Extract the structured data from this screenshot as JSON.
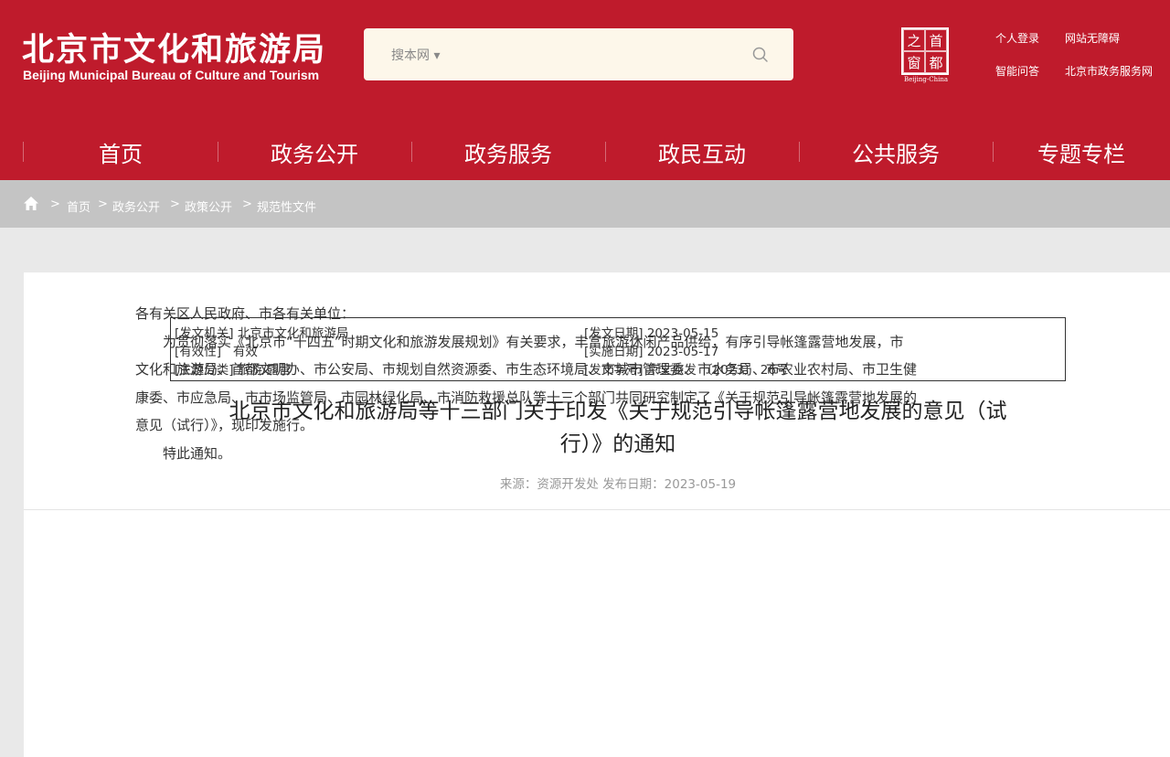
{
  "header": {
    "site_name_cn": "北京市文化和旅游局",
    "site_name_en": "Beijing Municipal Bureau of Culture and Tourism",
    "search": {
      "scope_label": "搜本网 ▾",
      "placeholder": ""
    },
    "capital_logo": {
      "chars": [
        "之",
        "首",
        "窗",
        "都"
      ],
      "en": "Beijing-China"
    },
    "links": {
      "login": "个人登录",
      "accessibility": "网站无障碍",
      "qa": "智能问答",
      "gov_service": "北京市政务服务网"
    },
    "brand_color": "#bf1b2c"
  },
  "nav": {
    "items": [
      {
        "label": "首页"
      },
      {
        "label": "政务公开"
      },
      {
        "label": "政务服务"
      },
      {
        "label": "政民互动"
      },
      {
        "label": "公共服务"
      },
      {
        "label": "专题专栏"
      }
    ]
  },
  "breadcrumb": {
    "sep": ">",
    "items": [
      "首页",
      "政务公开",
      "政策公开",
      "规范性文件"
    ]
  },
  "meta": {
    "issuer_label": "[发文机关]",
    "issuer": "北京市文化和旅游局",
    "validity_label": "[有效性]",
    "validity": "有效",
    "topic_label": "[主题分类]",
    "topic": "旅游/露营",
    "issue_date_label": "[发文日期]",
    "issue_date": "2023-05-15",
    "effective_date_label": "[实施日期]",
    "effective_date": "2023-05-17",
    "doc_no_label": "[发文字号]",
    "doc_no": "京文旅发 〔2023〕 26号"
  },
  "article": {
    "title_line1": "北京市文化和旅游局等十三部门关于印发《关于规范引导帐篷露营地发展的意见（试",
    "title_line2": "行）》的通知",
    "source": "来源：资源开发处   发布日期：2023-05-19",
    "salutation": "各有关区人民政府、市各有关单位：",
    "para1_l1": "为贯彻落实《北京市“十四五”时期文化和旅游发展规划》有关要求，丰富旅游休闲产品供给，有序引导帐篷露营地发展，市",
    "para1_l2": "文化和旅游局、首都文明办、市公安局、市规划自然资源委、市生态环境局、市城市管理委、市水务局、市农业农村局、市卫生健",
    "para1_l3": "康委、市应急局、市市场监管局、市园林绿化局、市消防救援总队等十三个部门共同研究制定了《关于规范引导帐篷露营地发展的",
    "para1_l4": "意见（试行）》，现印发施行。",
    "closing": "特此通知。"
  }
}
